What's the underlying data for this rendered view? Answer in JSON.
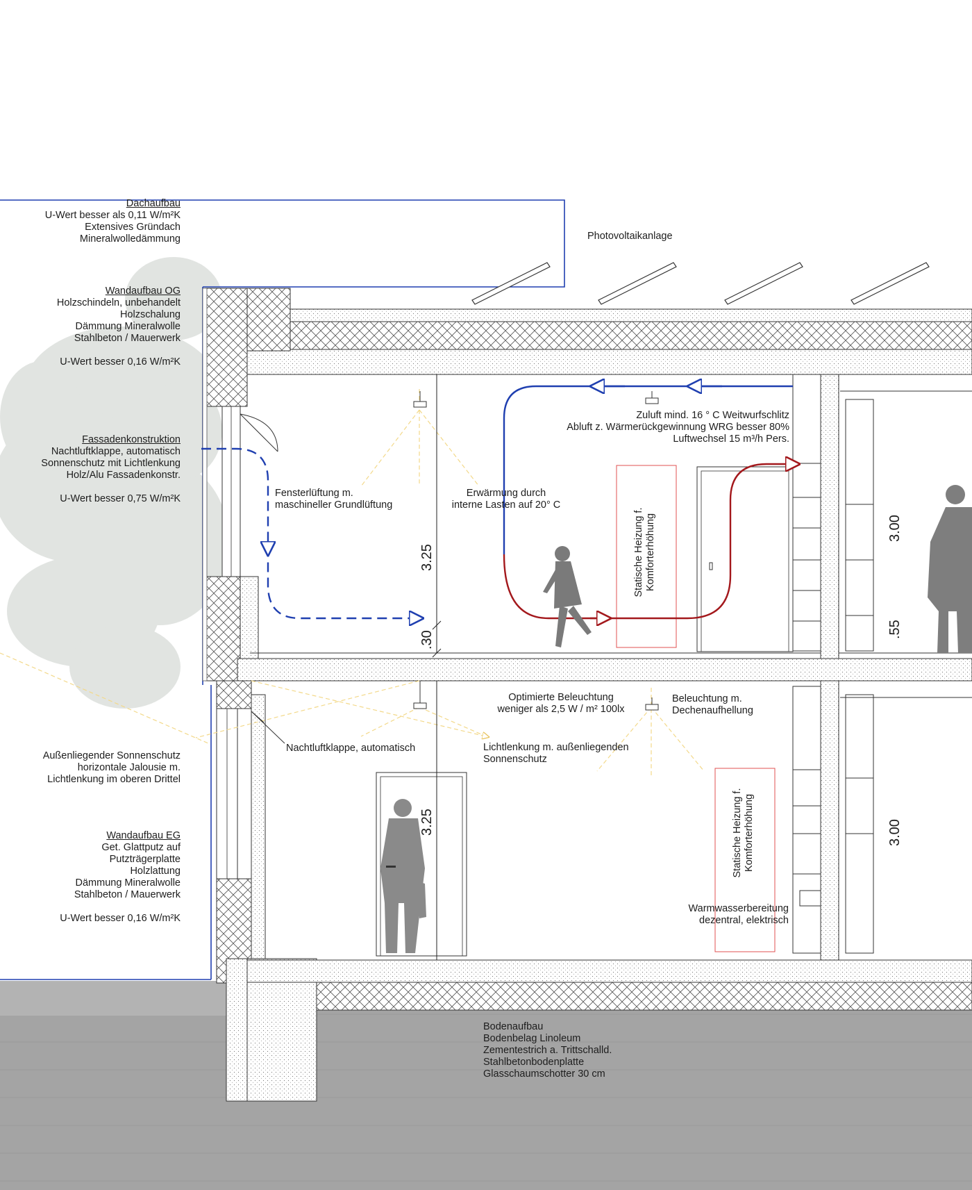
{
  "annotations": {
    "dachaufbau": {
      "title": "Dachaufbau",
      "lines": [
        "U-Wert besser als 0,11 W/m²K",
        "Extensives Gründach",
        "Mineralwolledämmung"
      ]
    },
    "photovoltaik": "Photovoltaikanlage",
    "wandaufbau_og": {
      "title": "Wandaufbau OG",
      "lines": [
        "Holzschindeln, unbehandelt",
        "Holzschalung",
        "Dämmung Mineralwolle",
        "Stahlbeton / Mauerwerk"
      ],
      "uwert": "U-Wert besser 0,16 W/m²K"
    },
    "fassade": {
      "title": "Fassadenkonstruktion",
      "lines": [
        "Nachtluftklappe, automatisch",
        "Sonnenschutz mit Lichtlenkung",
        "Holz/Alu Fassadenkonstr."
      ],
      "uwert": "U-Wert besser 0,75 W/m²K"
    },
    "sonnenschutz": {
      "lines": [
        "Außenliegender Sonnenschutz",
        "horizontale Jalousie m.",
        "Lichtlenkung im oberen Drittel"
      ]
    },
    "wandaufbau_eg": {
      "title": "Wandaufbau EG",
      "lines": [
        "Get. Glattputz auf",
        "Putzträgerplatte",
        "Holzlattung",
        "Dämmung Mineralwolle",
        "Stahlbeton / Mauerwerk"
      ],
      "uwert": "U-Wert besser 0,16 W/m²K"
    },
    "zuluft": {
      "lines": [
        "Zuluft mind. 16 ° C Weitwurfschlitz",
        "Abluft z. Wärmerückgewinnung WRG besser 80%",
        "Luftwechsel 15 m³/h Pers."
      ]
    },
    "fensterlueftung": {
      "lines": [
        "Fensterlüftung m.",
        "maschineller Grundlüftung"
      ]
    },
    "erwaermung": {
      "lines": [
        "Erwärmung durch",
        "interne Lasten auf 20° C"
      ]
    },
    "heizung_og": {
      "lines": [
        "Statische Heizung f.",
        "Komforterhöhung"
      ]
    },
    "heizung_eg": {
      "lines": [
        "Statische Heizung f.",
        "Komforterhöhung"
      ]
    },
    "beleuchtung_opt": {
      "lines": [
        "Optimierte Beleuchtung",
        "weniger als 2,5 W / m² 100lx"
      ]
    },
    "beleuchtung_decke": {
      "lines": [
        "Beleuchtung m.",
        "Dechenaufhellung"
      ]
    },
    "nachtluftklappe": "Nachtluftklappe, automatisch",
    "lichtlenkung": {
      "lines": [
        "Lichtlenkung m. außenliegenden",
        "Sonnenschutz"
      ]
    },
    "warmwasser": {
      "lines": [
        "Warmwasserbereitung",
        "dezentral, elektrisch"
      ]
    },
    "bodenaufbau": {
      "title": "Bodenaufbau",
      "lines": [
        "Bodenbelag Linoleum",
        "Zementestrich a. Trittschalld.",
        "Stahlbetonbodenplatte",
        "Glasschaumschotter 30 cm"
      ]
    }
  },
  "dimensions": {
    "og_height": "3.25",
    "og_slab": ".30",
    "eg_height": "3.25",
    "og_right_height": "3.00",
    "og_right_parapet": ".55",
    "eg_right_height": "3.00"
  },
  "colors": {
    "supply_air": "#1f3fb0",
    "exhaust_air": "#a3181c",
    "light_rays": "#f3d98a",
    "heater_outline": "#e05050",
    "ground": "#a4a4a4",
    "concrete_hatch": "#777777"
  }
}
